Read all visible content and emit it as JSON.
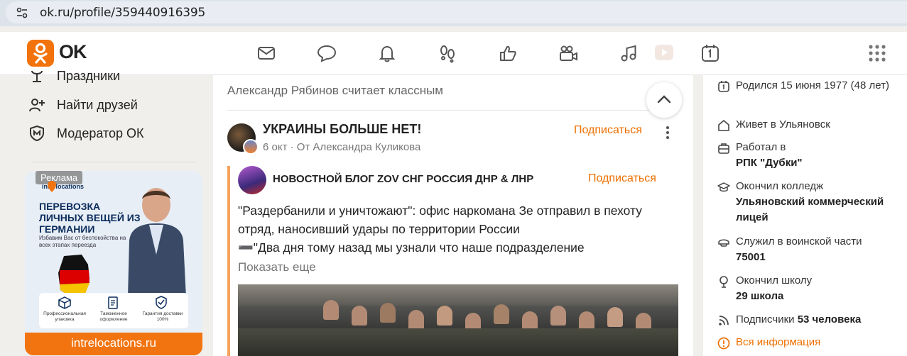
{
  "browser": {
    "url": "ok.ru/profile/359440916395"
  },
  "header": {
    "logo_text": "OK",
    "nav_icons": [
      "mail-icon",
      "chat-icon",
      "bell-icon",
      "footprints-icon",
      "thumbs-up-icon",
      "video-camera-icon",
      "music-note-icon",
      "video-play-icon",
      "calendar-icon"
    ]
  },
  "sidebar": {
    "items": [
      {
        "label": "Праздники",
        "icon": "gift-icon"
      },
      {
        "label": "Найти друзей",
        "icon": "add-friend-icon"
      },
      {
        "label": "Модератор ОК",
        "icon": "moderator-shield-icon"
      }
    ],
    "ad": {
      "badge": "Реклама",
      "logo": "intrelocations",
      "title": "ПЕРЕВОЗКА ЛИЧНЫХ ВЕЩЕЙ ИЗ ГЕРМАНИИ",
      "subtitle": "Избавим Вас от беспокойства на всех этапах переезда",
      "cards": [
        "Профессиональная упаковка",
        "Таможенное оформление",
        "Гарантия доставки 100%"
      ],
      "brand": "intrelocations.ru"
    }
  },
  "feed": {
    "liked_by": "Александр Рябинов считает классным",
    "post": {
      "title": "УКРАИНЫ БОЛЬШЕ НЕТ!",
      "meta": "6 окт · От Александра Куликова",
      "subscribe_label": "Подписаться",
      "repost": {
        "group_name": "НОВОСТНОЙ БЛОГ ZOV СНГ РОССИЯ ДНР & ЛНР",
        "subscribe_label": "Подписаться",
        "text_line1": "\"Раздербанили и уничтожают\": офис наркомана Зе отправил в пехоту",
        "text_line2": "отряд, наносивший удары по территории России",
        "text_line3": "➖\"Два дня тому назад мы узнали что наше подразделение",
        "show_more": "Показать еще"
      }
    }
  },
  "profile_info": {
    "born": "Родился 15 июня 1977 (48 лет)",
    "lives_prefix": "Живет в ",
    "lives_city": "Ульяновск",
    "worked_prefix": "Работал в",
    "worked_place": "РПК \"Дубки\"",
    "college_prefix": "Окончил колледж",
    "college_name": "Ульяновский коммерческий лицей",
    "military_prefix": "Служил в воинской части",
    "military_unit": "75001",
    "school_prefix": "Окончил школу",
    "school_name": "29 школа",
    "subscribers_prefix": "Подписчики ",
    "subscribers_count": "53 человека",
    "all_info": "Вся информация"
  },
  "colors": {
    "brand_orange": "#ee6f00",
    "logo_orange": "#f2720c"
  }
}
